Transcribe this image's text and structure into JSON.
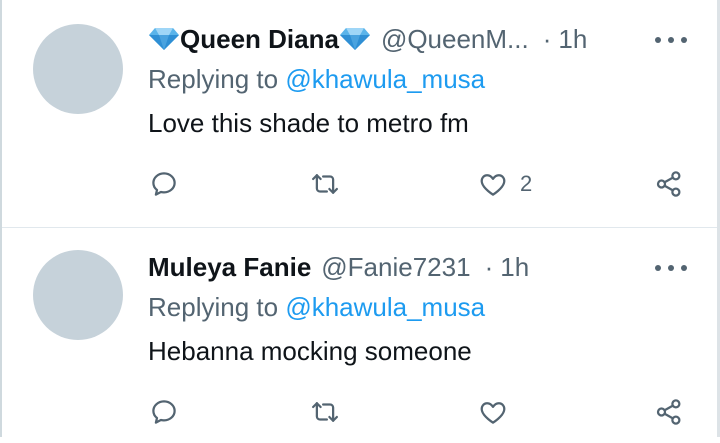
{
  "tweets": [
    {
      "display_name": "Queen Diana",
      "handle": "@QueenM...",
      "separator": "·",
      "time": "1h",
      "replying_prefix": "Replying to",
      "replying_to": "@khawula_musa",
      "text": "Love this shade to metro fm",
      "like_count": "2",
      "icons": [
        "gem-icon",
        "more-icon",
        "reply-icon",
        "retweet-icon",
        "like-icon",
        "share-icon"
      ]
    },
    {
      "display_name": "Muleya Fanie",
      "handle": "@Fanie7231",
      "separator": "·",
      "time": "1h",
      "replying_prefix": "Replying to",
      "replying_to": "@khawula_musa",
      "text": "Hebanna mocking someone",
      "like_count": "",
      "icons": [
        "more-icon",
        "reply-icon",
        "retweet-icon",
        "like-icon",
        "share-icon"
      ]
    }
  ],
  "colors": {
    "text_primary": "#0f1419",
    "text_secondary": "#536471",
    "link": "#1d9bf0",
    "avatar_placeholder": "#c6d2da",
    "gem": "#4aa3df"
  }
}
